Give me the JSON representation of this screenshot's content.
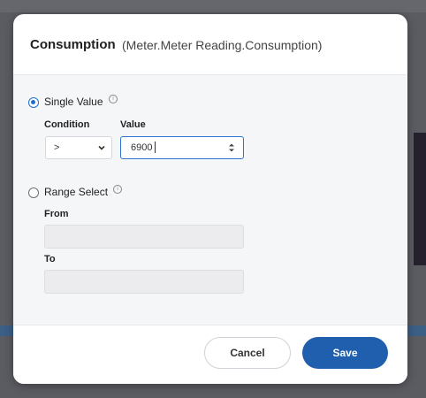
{
  "dialog": {
    "title": "Consumption",
    "subtitle": "(Meter.Meter Reading.Consumption)"
  },
  "single_value": {
    "label": "Single Value",
    "selected": true,
    "condition_label": "Condition",
    "value_label": "Value",
    "condition_selected": ">",
    "value_input": "6900"
  },
  "range_select": {
    "label": "Range Select",
    "selected": false,
    "from_label": "From",
    "to_label": "To",
    "from_value": "",
    "to_value": ""
  },
  "footer": {
    "cancel_label": "Cancel",
    "save_label": "Save"
  },
  "colors": {
    "accent": "#1f6fd1",
    "save_button": "#1f5fad"
  },
  "icons": {
    "info": "info-icon",
    "dropdown": "chevron-down-icon",
    "stepper": "stepper-icon"
  }
}
